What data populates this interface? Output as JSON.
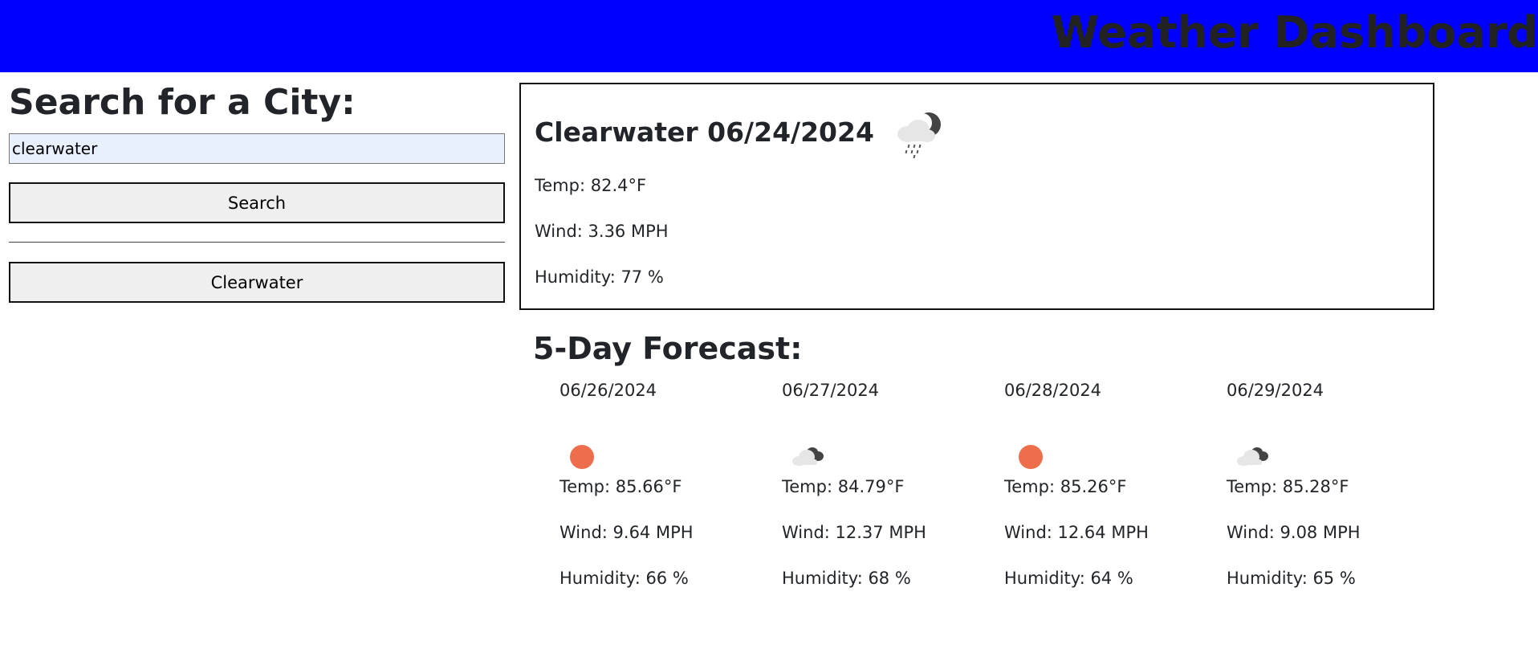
{
  "header": {
    "title": "Weather Dashboard"
  },
  "search": {
    "heading": "Search for a City:",
    "input_value": "clearwater",
    "button_label": "Search"
  },
  "history": [
    {
      "label": "Clearwater"
    }
  ],
  "current": {
    "title": "Clearwater 06/24/2024",
    "icon": "cloud-rain-night-icon",
    "temp": "Temp: 82.4°F",
    "wind": "Wind: 3.36 MPH",
    "humidity": "Humidity: 77 %"
  },
  "forecast": {
    "heading": "5-Day Forecast:",
    "days": [
      {
        "date": "06/26/2024",
        "icon": "sun-icon",
        "temp": "Temp: 85.66°F",
        "wind": "Wind: 9.64 MPH",
        "humidity": "Humidity: 66 %"
      },
      {
        "date": "06/27/2024",
        "icon": "broken-clouds-icon",
        "temp": "Temp: 84.79°F",
        "wind": "Wind: 12.37 MPH",
        "humidity": "Humidity: 68 %"
      },
      {
        "date": "06/28/2024",
        "icon": "sun-icon",
        "temp": "Temp: 85.26°F",
        "wind": "Wind: 12.64 MPH",
        "humidity": "Humidity: 64 %"
      },
      {
        "date": "06/29/2024",
        "icon": "broken-clouds-icon",
        "temp": "Temp: 85.28°F",
        "wind": "Wind: 9.08 MPH",
        "humidity": "Humidity: 65 %"
      }
    ]
  },
  "colors": {
    "header_bg": "#0000ff",
    "sun": "#ee6e4c",
    "cloud_dark": "#444444",
    "cloud_light": "#e6e6e6"
  }
}
